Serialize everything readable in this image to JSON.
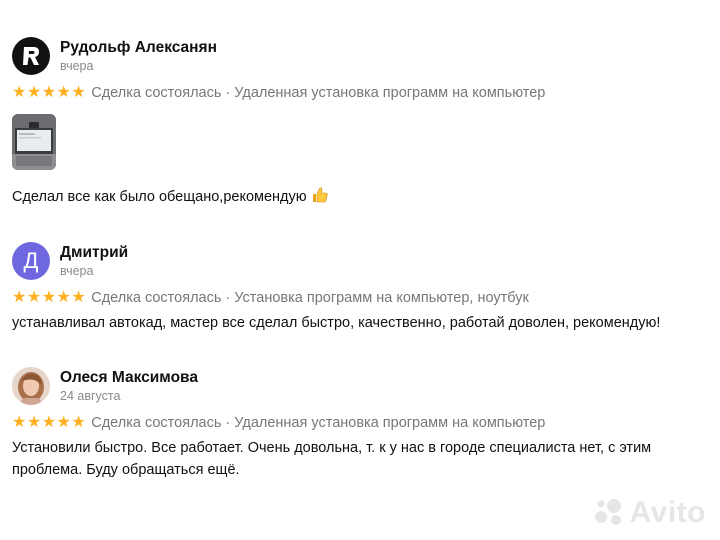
{
  "reviews": [
    {
      "author": "Рудольф Алексанян",
      "date": "вчера",
      "rating": 5,
      "deal": "Сделка состоялась · Удаленная установка программ на компьютер",
      "text": "Сделал все как было обещано,рекомендую",
      "avatar_icon": "r-logo-icon",
      "has_photo": true
    },
    {
      "author": "Дмитрий",
      "date": "вчера",
      "rating": 5,
      "deal": "Сделка состоялась · Установка программ на компьютер, ноутбук",
      "text": "устанавливал автокад, мастер все сделал быстро, качественно, работай доволен, рекомендую!",
      "avatar_letter": "Д"
    },
    {
      "author": "Олеся Максимова",
      "date": "24 августа",
      "rating": 5,
      "deal": "Сделка состоялась · Удаленная установка программ на компьютер",
      "text_line1": "Установили быстро. Все работает. Очень довольна, т. к у нас в городе специалиста нет, с этим",
      "text_line2": "проблема. Буду обращаться ещё."
    }
  ],
  "watermark": "Avito",
  "colors": {
    "star": "#ffb021",
    "letter_avatar": "#6e67e0",
    "muted_text": "#777777"
  }
}
